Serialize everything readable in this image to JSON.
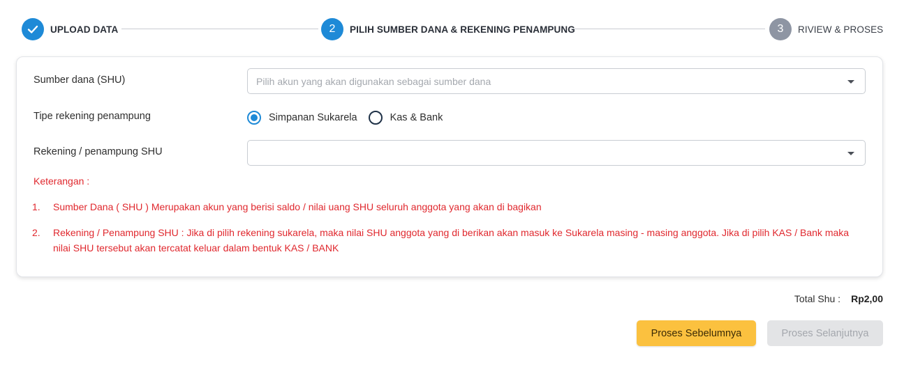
{
  "stepper": {
    "steps": [
      {
        "number": "",
        "label": "UPLOAD DATA",
        "state": "done"
      },
      {
        "number": "2",
        "label": "PILIH SUMBER DANA & REKENING PENAMPUNG",
        "state": "active"
      },
      {
        "number": "3",
        "label": "RIVIEW & PROSES",
        "state": "pending"
      }
    ]
  },
  "form": {
    "source_label": "Sumber dana (SHU)",
    "source_placeholder": "Pilih akun yang akan digunakan sebagai sumber dana",
    "account_type_label": "Tipe rekening penampung",
    "account_type_options": [
      "Simpanan Sukarela",
      "Kas & Bank"
    ],
    "account_type_selected": "Simpanan Sukarela",
    "target_label": "Rekening / penampung SHU",
    "target_value": ""
  },
  "notes": {
    "title": "Keterangan :",
    "items": [
      {
        "num": "1.",
        "text": "Sumber Dana ( SHU ) Merupakan akun yang berisi saldo / nilai uang SHU seluruh anggota yang akan di bagikan"
      },
      {
        "num": "2.",
        "text": "Rekening / Penampung SHU : Jika di pilih rekening sukarela, maka nilai SHU anggota yang di berikan akan masuk ke Sukarela masing - masing anggota. Jika di pilih KAS / Bank maka nilai SHU tersebut akan tercatat keluar dalam bentuk KAS / BANK"
      }
    ]
  },
  "summary": {
    "total_label": "Total Shu :",
    "total_value": "Rp2,00"
  },
  "actions": {
    "prev_label": "Proses Sebelumnya",
    "next_label": "Proses Selanjutnya"
  },
  "colors": {
    "primary": "#1e8ad7",
    "warning": "#fbc13f",
    "danger_text": "#e0282e",
    "disabled": "#e3e4e6"
  }
}
